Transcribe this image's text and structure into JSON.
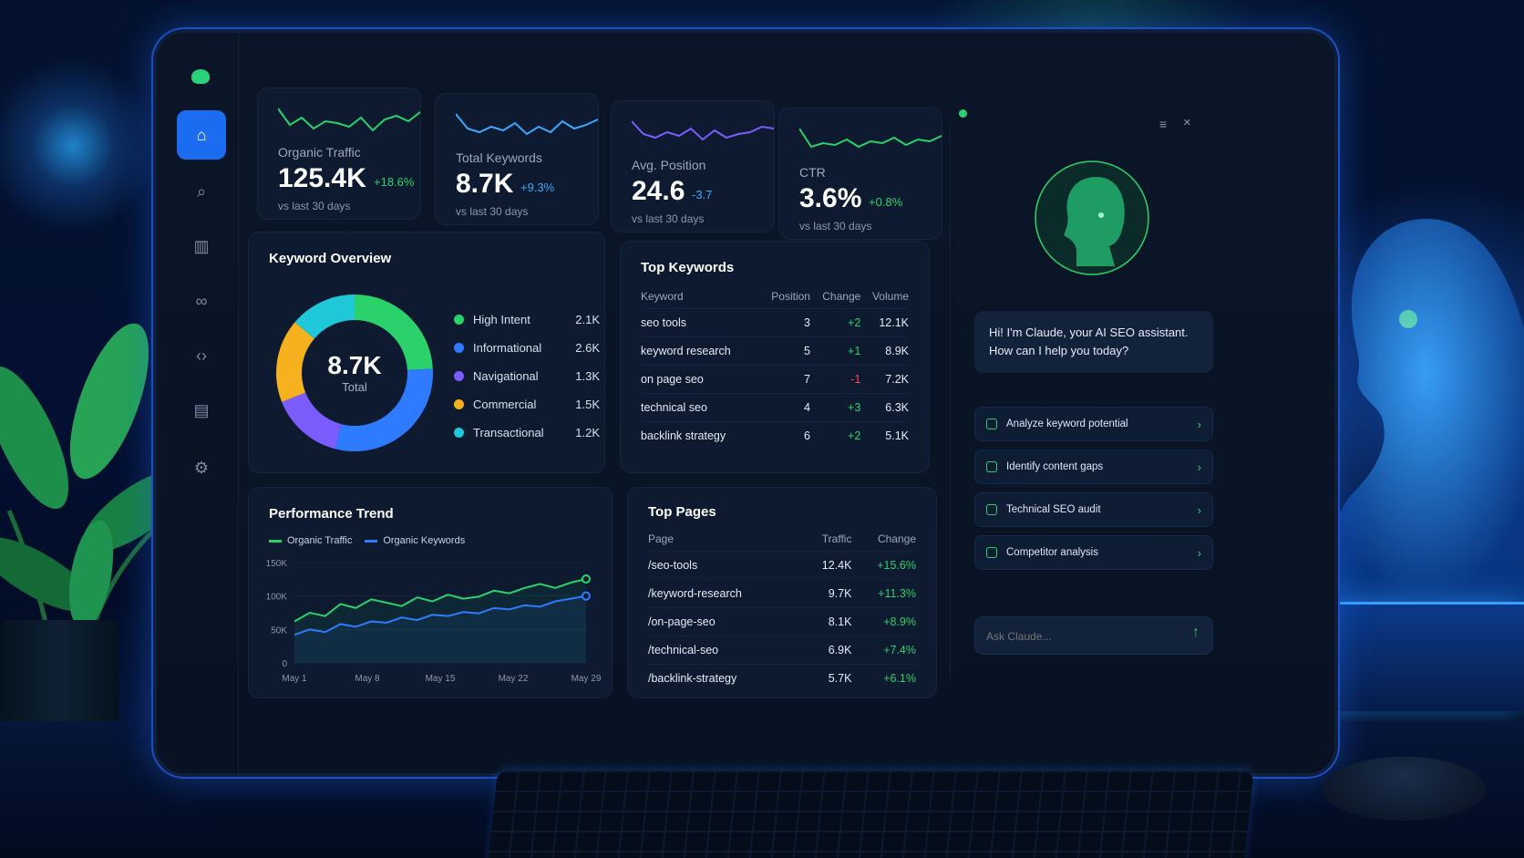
{
  "stats": [
    {
      "label": "Organic Traffic",
      "value": "125.4K",
      "change": "+18.6%",
      "sub": "vs last 30 days",
      "color": "#2bd26b"
    },
    {
      "label": "Total Keywords",
      "value": "8.7K",
      "change": "+9.3%",
      "sub": "vs last 30 days",
      "color": "#3fa7ff"
    },
    {
      "label": "Avg. Position",
      "value": "24.6",
      "change": "-3.7",
      "sub": "vs last 30 days",
      "color": "#7b5cff"
    },
    {
      "label": "CTR",
      "value": "3.6%",
      "change": "+0.8%",
      "sub": "vs last 30 days",
      "color": "#2bd26b"
    }
  ],
  "keyword_overview": {
    "title": "Keyword Overview",
    "total_value": "8.7K",
    "total_label": "Total",
    "items": [
      {
        "name": "High Intent",
        "value": "2.1K",
        "color": "#2bd26b"
      },
      {
        "name": "Informational",
        "value": "2.6K",
        "color": "#2e7bff"
      },
      {
        "name": "Navigational",
        "value": "1.3K",
        "color": "#7b5cff"
      },
      {
        "name": "Commercial",
        "value": "1.5K",
        "color": "#f5b21e"
      },
      {
        "name": "Transactional",
        "value": "1.2K",
        "color": "#1ec8d8"
      }
    ]
  },
  "top_keywords": {
    "title": "Top Keywords",
    "headers": [
      "Keyword",
      "Position",
      "Change",
      "Volume"
    ],
    "rows": [
      [
        "seo tools",
        "3",
        "+2",
        "12.1K"
      ],
      [
        "keyword research",
        "5",
        "+1",
        "8.9K"
      ],
      [
        "on page seo",
        "7",
        "-1",
        "7.2K"
      ],
      [
        "technical seo",
        "4",
        "+3",
        "6.3K"
      ],
      [
        "backlink strategy",
        "6",
        "+2",
        "5.1K"
      ]
    ]
  },
  "performance": {
    "title": "Performance Trend",
    "legend": [
      "Organic Traffic",
      "Organic Keywords"
    ]
  },
  "chart_data": {
    "type": "line",
    "x": [
      "May 1",
      "May 8",
      "May 15",
      "May 22",
      "May 29"
    ],
    "ylim": [
      0,
      150000
    ],
    "yticks": [
      "0",
      "50K",
      "100K",
      "150K"
    ],
    "series": [
      {
        "name": "Organic Traffic",
        "color": "#2bd26b",
        "values": [
          62000,
          75000,
          70000,
          88000,
          82000,
          95000,
          90000,
          85000,
          98000,
          92000,
          102000,
          96000,
          99000,
          108000,
          104000,
          112000,
          118000,
          112000,
          120000,
          125400
        ]
      },
      {
        "name": "Organic Keywords",
        "color": "#2e7bff",
        "values": [
          42000,
          50000,
          46000,
          58000,
          54000,
          62000,
          60000,
          68000,
          64000,
          72000,
          70000,
          76000,
          74000,
          82000,
          80000,
          86000,
          84000,
          92000,
          96000,
          100000
        ]
      }
    ]
  },
  "top_pages": {
    "title": "Top Pages",
    "headers": [
      "Page",
      "Traffic",
      "Change"
    ],
    "rows": [
      [
        "/seo-tools",
        "12.4K",
        "+15.6%"
      ],
      [
        "/keyword-research",
        "9.7K",
        "+11.3%"
      ],
      [
        "/on-page-seo",
        "8.1K",
        "+8.9%"
      ],
      [
        "/technical-seo",
        "6.9K",
        "+7.4%"
      ],
      [
        "/backlink-strategy",
        "5.7K",
        "+6.1%"
      ]
    ]
  },
  "assistant": {
    "greeting": "Hi! I'm Claude, your AI SEO assistant. How can I help you today?",
    "actions": [
      "Analyze keyword potential",
      "Identify content gaps",
      "Technical SEO audit",
      "Competitor analysis"
    ],
    "input_placeholder": "Ask Claude..."
  }
}
